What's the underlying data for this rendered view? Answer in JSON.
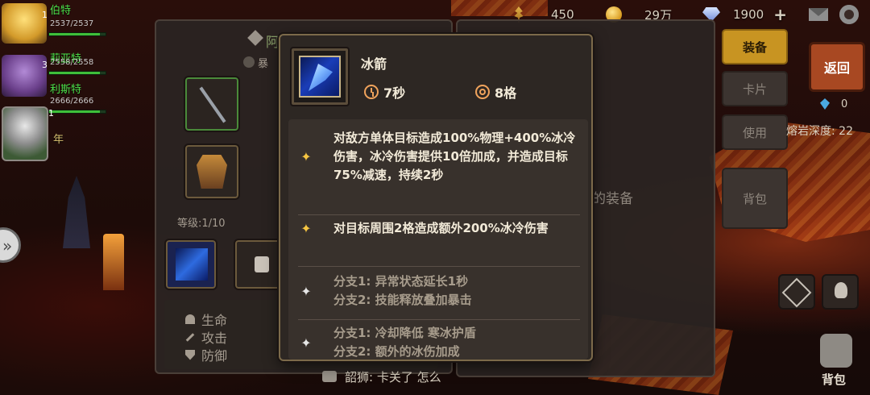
{
  "hud": {
    "food": "450",
    "gold": "29万",
    "gems": "1900",
    "add_symbol": "+"
  },
  "party": [
    {
      "name": "伯特",
      "hp": "2537/2537",
      "level": "1",
      "hp_fraction": 0.9
    },
    {
      "name": "莉亚特",
      "hp": "2558/2558",
      "level": "3",
      "hp_fraction": 0.9
    },
    {
      "name": "利斯特",
      "hp": "2666/2666",
      "level": "",
      "hp_fraction": 0.9
    },
    {
      "name": "年",
      "hp": "",
      "level": "1",
      "hp_fraction": 0.9
    }
  ],
  "equip_panel": {
    "title_fragment": "阿",
    "crit_fragment": "暴",
    "level_label": "等级:1/10",
    "stats": [
      {
        "icon": "heart-icon",
        "label": "生命"
      },
      {
        "icon": "sword-icon",
        "label": "攻击"
      },
      {
        "icon": "shield-icon",
        "label": "防御"
      }
    ]
  },
  "right_menu": {
    "equip": "装备",
    "cards": "卡片",
    "use": "使用",
    "backpack": "背包",
    "return": "返回",
    "crystal_count": "0",
    "depth_label": "熔岩深度: 22",
    "equipment_fragment": "出的装备",
    "bag_label": "背包"
  },
  "chat_fragment": "韶狮: 卡关了 怎么",
  "tooltip": {
    "skill_name": "冰箭",
    "cooldown": "7秒",
    "range": "8格",
    "entries": [
      {
        "star": "gold",
        "text": "对敌方单体目标造成100%物理+400%冰冷伤害，冰冷伤害提供10倍加成，并造成目标75%减速，持续2秒"
      },
      {
        "star": "gold",
        "text": "对目标周围2格造成额外200%冰冷伤害"
      },
      {
        "star": "silver",
        "text": "分支1: 异常状态延长1秒"
      },
      {
        "star": "silver",
        "text": "分支2: 技能释放叠加暴击"
      },
      {
        "star": "silver",
        "text": "分支1: 冷却降低 寒冰护盾"
      },
      {
        "star": "silver",
        "text": "分支2: 额外的冰伤加成"
      }
    ]
  },
  "colors": {
    "accent_gold": "#c89422",
    "hp_green": "#3fbf3a",
    "tooltip_border": "#7c6a4a",
    "gold_star": "#f5c542",
    "silver_star": "#e6e6e6"
  }
}
